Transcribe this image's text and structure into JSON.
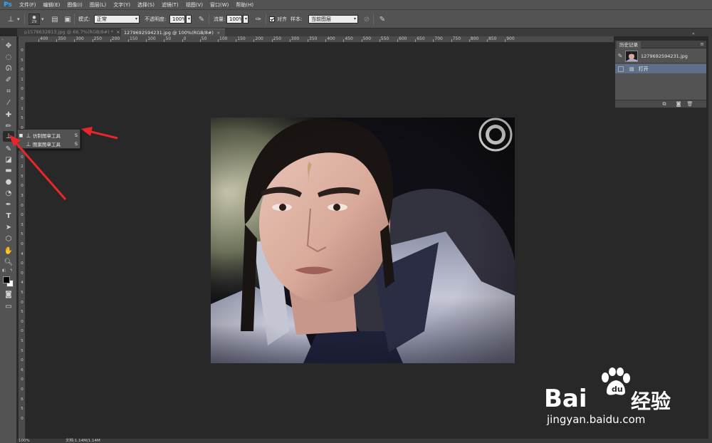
{
  "app": {
    "logo": "Ps"
  },
  "menu": [
    "文件(F)",
    "编辑(E)",
    "图像(I)",
    "图层(L)",
    "文字(Y)",
    "选择(S)",
    "滤镜(T)",
    "视图(V)",
    "窗口(W)",
    "帮助(H)"
  ],
  "options": {
    "brush_size": "29",
    "mode_label": "模式:",
    "mode_value": "正常",
    "opacity_label": "不透明度:",
    "opacity_value": "100%",
    "flow_label": "流量:",
    "flow_value": "100%",
    "aligned_label": "对齐",
    "sample_label": "样本:",
    "sample_value": "当前图层"
  },
  "tabs": [
    {
      "label": "p1578632813.jpg @ 66.7%(RGB/8#) *",
      "close": "×",
      "active": false
    },
    {
      "label": "1279692594231.jpg @ 100%(RGB/8#)",
      "close": "×",
      "active": true
    }
  ],
  "ruler_top": [
    "400",
    "350",
    "300",
    "250",
    "200",
    "150",
    "100",
    "50",
    "0",
    "50",
    "100",
    "150",
    "200",
    "250",
    "300",
    "350",
    "400",
    "450",
    "500",
    "550",
    "600",
    "650",
    "700",
    "750",
    "800",
    "850",
    "900"
  ],
  "ruler_left": [
    "0",
    "5",
    "0",
    "1",
    "0",
    "0",
    "1",
    "5",
    "0",
    "2",
    "0",
    "0",
    "2",
    "5",
    "0",
    "3",
    "0",
    "0",
    "3",
    "5",
    "0",
    "4",
    "0",
    "0",
    "4",
    "5",
    "0",
    "5",
    "0",
    "0",
    "5",
    "5",
    "0",
    "6",
    "0",
    "0",
    "6",
    "5",
    "0"
  ],
  "flyout": {
    "items": [
      {
        "label": "仿制图章工具",
        "key": "S",
        "selected": true,
        "marker": "■"
      },
      {
        "label": "图案图章工具",
        "key": "S",
        "selected": false,
        "marker": ""
      }
    ]
  },
  "history": {
    "title": "历史记录",
    "menu_icon": "≡",
    "snapshot_name": "1279692594231.jpg",
    "steps": [
      {
        "label": "打开"
      }
    ]
  },
  "status": {
    "zoom": "100%",
    "doc": "文档:1.14M/1.14M"
  },
  "watermark": {
    "brand": "Bai",
    "brand_cn": "经验",
    "url": "jingyan.baidu.com"
  },
  "colors": {
    "accent": "#31a8ff",
    "arrow": "#e8262b",
    "panel": "#535353",
    "workspace": "#282828",
    "history_selected": "#5f6f8a"
  },
  "icons": [
    "move-icon",
    "marquee-icon",
    "lasso-icon",
    "quick-select-icon",
    "crop-icon",
    "eyedropper-icon",
    "healing-brush-icon",
    "brush-icon",
    "clone-stamp-icon",
    "history-brush-icon",
    "eraser-icon",
    "gradient-icon",
    "blur-icon",
    "dodge-icon",
    "pen-icon",
    "type-icon",
    "path-select-icon",
    "shape-icon",
    "hand-icon",
    "zoom-icon"
  ]
}
